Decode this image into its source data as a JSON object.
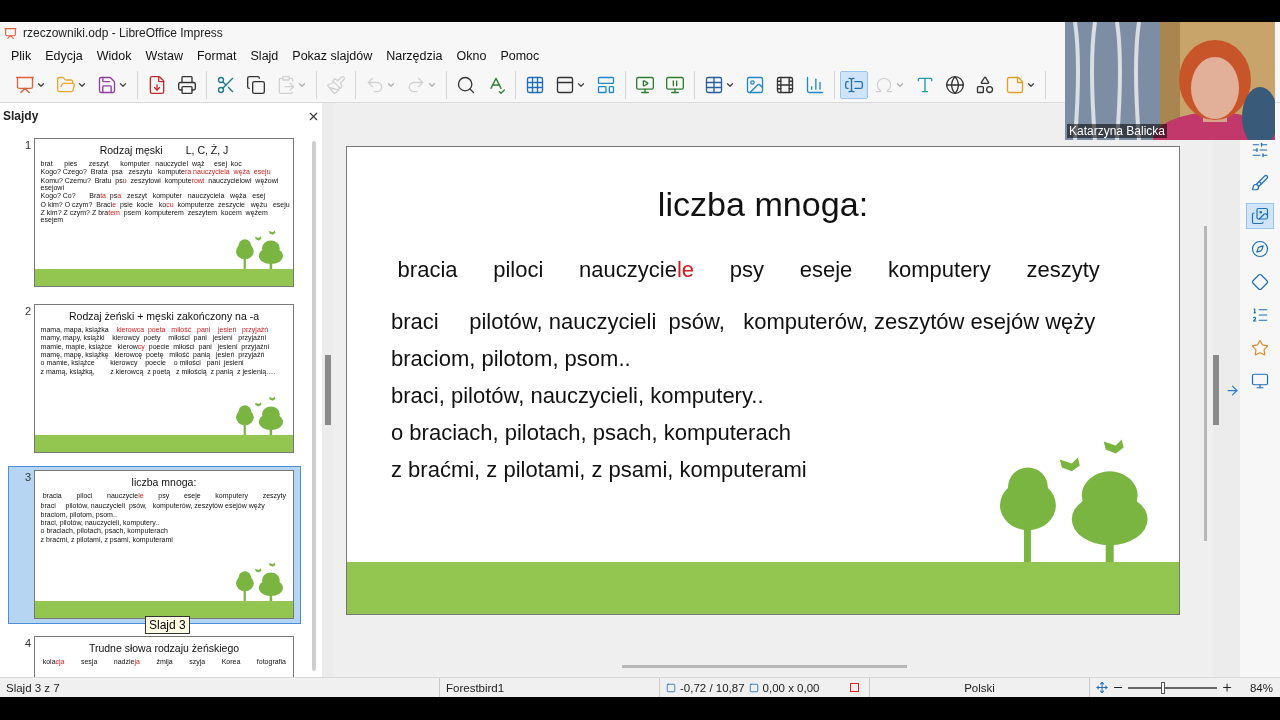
{
  "window": {
    "title": "rzeczowniki.odp - LibreOffice Impress"
  },
  "menu": [
    "Plik",
    "Edycja",
    "Widok",
    "Wstaw",
    "Format",
    "Slajd",
    "Pokaz slajdów",
    "Narzędzia",
    "Okno",
    "Pomoc"
  ],
  "toolbar": [
    [
      {
        "disabled": false,
        "selected": false,
        "dropdown": true
      },
      {
        "disabled": false,
        "selected": false,
        "dropdown": true
      },
      {
        "disabled": false,
        "selected": false,
        "dropdown": true
      }
    ],
    [
      {
        "disabled": false,
        "selected": false,
        "dropdown": false
      },
      {
        "disabled": false,
        "selected": false,
        "dropdown": false
      }
    ],
    [
      {
        "disabled": false,
        "selected": false,
        "dropdown": false
      },
      {
        "disabled": false,
        "selected": false,
        "dropdown": false
      },
      {
        "disabled": true,
        "selected": false,
        "dropdown": true
      }
    ],
    [
      {
        "disabled": true,
        "selected": false,
        "dropdown": false
      }
    ],
    [
      {
        "disabled": true,
        "selected": false,
        "dropdown": true
      },
      {
        "disabled": true,
        "selected": false,
        "dropdown": true
      }
    ],
    [
      {
        "disabled": false,
        "selected": false,
        "dropdown": false
      },
      {
        "disabled": false,
        "selected": false,
        "dropdown": false
      }
    ],
    [
      {
        "disabled": false,
        "selected": false,
        "dropdown": false
      },
      {
        "disabled": false,
        "selected": false,
        "dropdown": true
      },
      {
        "disabled": false,
        "selected": false,
        "dropdown": false
      }
    ],
    [
      {
        "disabled": false,
        "selected": false,
        "dropdown": false
      },
      {
        "disabled": false,
        "selected": false,
        "dropdown": false
      }
    ],
    [
      {
        "disabled": false,
        "selected": false,
        "dropdown": true
      },
      {
        "disabled": false,
        "selected": false,
        "dropdown": false
      },
      {
        "disabled": false,
        "selected": false,
        "dropdown": false
      },
      {
        "disabled": false,
        "selected": false,
        "dropdown": false
      }
    ],
    [
      {
        "disabled": false,
        "selected": true,
        "dropdown": false
      },
      {
        "disabled": true,
        "selected": false,
        "dropdown": true
      },
      {
        "disabled": false,
        "selected": false,
        "dropdown": false
      },
      {
        "disabled": false,
        "selected": false,
        "dropdown": false
      },
      {
        "disabled": false,
        "selected": false,
        "dropdown": false
      },
      {
        "disabled": false,
        "selected": false,
        "dropdown": true
      }
    ]
  ],
  "slides_panel": {
    "title": "Slajdy"
  },
  "slides": [
    {
      "number": "1",
      "selected": false,
      "title": [
        "Rodzaj męski",
        "L, C, Ż, J"
      ],
      "rows": [
        {
          "kind": "line",
          "parts": [
            {
              "text": "brat      pies      zeszyt      komputer   nauczyciel  wąż     esej  koc",
              "highlight": false
            }
          ]
        },
        {
          "kind": "line",
          "parts": [
            {
              "text": "Kogo? Czego?  Brata  psa   zeszytu   kompute",
              "highlight": false
            },
            {
              "text": "ra nauczyciela  węża  eseju",
              "highlight": true
            }
          ]
        },
        {
          "kind": "line",
          "parts": [
            {
              "text": "Komu? Czemu?  Bratu  ps",
              "highlight": false
            },
            {
              "text": "u",
              "highlight": true
            },
            {
              "text": "  zeszytowi  kompute",
              "highlight": false
            },
            {
              "text": "rowi",
              "highlight": true
            },
            {
              "text": "  nauczycielowi  wężowi  esejowi",
              "highlight": false
            }
          ]
        },
        {
          "kind": "line",
          "parts": [
            {
              "text": "Kogo? Co?       Bra",
              "highlight": false
            },
            {
              "text": "ta",
              "highlight": true
            },
            {
              "text": "  ps",
              "highlight": false
            },
            {
              "text": "a",
              "highlight": true
            },
            {
              "text": "   zeszyt   komputer   nauczyciela   węża   esej",
              "highlight": false
            }
          ]
        },
        {
          "kind": "line",
          "parts": [
            {
              "text": "O kim? O czym?  Braci",
              "highlight": false
            },
            {
              "text": "e",
              "highlight": true
            },
            {
              "text": "  psie  kocie   ko",
              "highlight": false
            },
            {
              "text": "cu",
              "highlight": true
            },
            {
              "text": "  komputerze  zeszycie   wężu   eseju",
              "highlight": false
            }
          ]
        },
        {
          "kind": "line",
          "parts": [
            {
              "text": "Z kim? Z czym? Z bra",
              "highlight": false
            },
            {
              "text": "tem",
              "highlight": true
            },
            {
              "text": "  psem  komputerem  zeszytem  kocem  wężem  esejem",
              "highlight": false
            }
          ]
        }
      ]
    },
    {
      "number": "2",
      "selected": false,
      "title": [
        "Rodzaj żeński + męski zakończony na -a"
      ],
      "rows": [
        {
          "kind": "line",
          "parts": [
            {
              "text": "mama, mapa, książka    ",
              "highlight": false
            },
            {
              "text": "kierowca  poeta   miłość   pani    jesień   przyjaźń",
              "highlight": true
            }
          ]
        },
        {
          "kind": "line",
          "parts": [
            {
              "text": "mamy, mapy, książki    kierowcy  poety    miłości  pani   jesieni   przyjaźni",
              "highlight": false
            }
          ]
        },
        {
          "kind": "line",
          "parts": [
            {
              "text": "mamie, mapie, książce   kierow",
              "highlight": false
            },
            {
              "text": "cy",
              "highlight": true
            },
            {
              "text": "  poecie  miłości  pani   jesieni  przyjaźni",
              "highlight": false
            }
          ]
        },
        {
          "kind": "line",
          "parts": [
            {
              "text": "mamę, mapę, książkę   kierowcę  poetę   miłość  panią   jesień  przyjaźń",
              "highlight": false
            }
          ]
        },
        {
          "kind": "line",
          "parts": [
            {
              "text": "o mamie, książce        kierowcy    poecie    o miłości   pani  jesieni",
              "highlight": false
            }
          ]
        },
        {
          "kind": "line",
          "parts": [
            {
              "text": "z mamą, książką,        z kierowcą  z poetą   z miłością  z panią  z jesienią….",
              "highlight": false
            }
          ]
        }
      ]
    },
    {
      "number": "3",
      "selected": true,
      "title": [
        "liczba mnoga:"
      ],
      "rows": [
        {
          "kind": "words",
          "words": [
            [
              {
                "text": "bracia",
                "highlight": false
              }
            ],
            [
              {
                "text": "piloci",
                "highlight": false
              }
            ],
            [
              {
                "text": "nauczycie",
                "highlight": false
              },
              {
                "text": "le",
                "highlight": true
              }
            ],
            [
              {
                "text": "psy",
                "highlight": false
              }
            ],
            [
              {
                "text": "eseje",
                "highlight": false
              }
            ],
            [
              {
                "text": "komputery",
                "highlight": false
              }
            ],
            [
              {
                "text": "zeszyty",
                "highlight": false
              }
            ]
          ]
        },
        {
          "kind": "line",
          "parts": [
            {
              "text": "braci     pilotów, nauczycieli  psów,   komputerów, zeszytów esejów węży",
              "highlight": false
            }
          ]
        },
        {
          "kind": "line",
          "parts": [
            {
              "text": "braciom, pilotom, psom..",
              "highlight": false
            }
          ]
        },
        {
          "kind": "line",
          "parts": [
            {
              "text": "braci, pilotów, nauczycieli, komputery..",
              "highlight": false
            }
          ]
        },
        {
          "kind": "line",
          "parts": [
            {
              "text": "o braciach, pilotach, psach, komputerach",
              "highlight": false
            }
          ]
        },
        {
          "kind": "line",
          "parts": [
            {
              "text": "z braćmi, z pilotami, z psami, komputerami",
              "highlight": false
            }
          ]
        }
      ]
    },
    {
      "number": "4",
      "selected": false,
      "title": [
        "Trudne słowa rodzaju żeńskiego"
      ],
      "rows": [
        {
          "kind": "words",
          "words": [
            [
              {
                "text": "kola",
                "highlight": false
              },
              {
                "text": "cja",
                "highlight": true
              }
            ],
            [
              {
                "text": "sesja",
                "highlight": false
              }
            ],
            [
              {
                "text": "nadzie",
                "highlight": false
              },
              {
                "text": "ja",
                "highlight": true
              }
            ],
            [
              {
                "text": "żmija",
                "highlight": false
              }
            ],
            [
              {
                "text": "szyja",
                "highlight": false
              }
            ],
            [
              {
                "text": "Korea",
                "highlight": false
              }
            ],
            [
              {
                "text": "fotografia",
                "highlight": false
              }
            ]
          ]
        }
      ]
    }
  ],
  "tooltip": "Slajd 3",
  "current_slide": {
    "title": [
      "liczba mnoga:"
    ],
    "rows": [
      {
        "kind": "words",
        "words": [
          [
            {
              "text": "bracia",
              "highlight": false
            }
          ],
          [
            {
              "text": "piloci",
              "highlight": false
            }
          ],
          [
            {
              "text": "nauczycie",
              "highlight": false
            },
            {
              "text": "le",
              "highlight": true
            }
          ],
          [
            {
              "text": "psy",
              "highlight": false
            }
          ],
          [
            {
              "text": "eseje",
              "highlight": false
            }
          ],
          [
            {
              "text": "komputery",
              "highlight": false
            }
          ],
          [
            {
              "text": "zeszyty",
              "highlight": false
            }
          ]
        ]
      },
      {
        "kind": "line",
        "parts": [
          {
            "text": "braci     pilotów, nauczycieli  psów,   komputerów, zeszytów esejów węży",
            "highlight": false
          }
        ]
      },
      {
        "kind": "line",
        "parts": [
          {
            "text": "braciom, pilotom, psom..",
            "highlight": false
          }
        ]
      },
      {
        "kind": "line",
        "parts": [
          {
            "text": "braci, pilotów, nauczycieli, komputery..",
            "highlight": false
          }
        ]
      },
      {
        "kind": "line",
        "parts": [
          {
            "text": "o braciach, pilotach, psach, komputerach",
            "highlight": false
          }
        ]
      },
      {
        "kind": "line",
        "parts": [
          {
            "text": "z braćmi, z pilotami, z psami, komputerami",
            "highlight": false
          }
        ]
      }
    ]
  },
  "sidebar_tabs": [
    {
      "selected": false
    },
    {
      "selected": false
    },
    {
      "selected": true
    },
    {
      "selected": false
    },
    {
      "selected": false
    },
    {
      "selected": false
    },
    {
      "selected": false
    },
    {
      "selected": false
    }
  ],
  "webcam": {
    "kind": "picture",
    "name": "Katarzyna Balicka"
  },
  "status_bar": {
    "slide": "Slajd 3 z 7",
    "master": "Forestbird1",
    "position": "-0,72 / 10,87",
    "size": "0,00 x 0,00",
    "document_modified": true,
    "language": "Polski",
    "zoom": {
      "level": 0.39,
      "reading": "84%"
    }
  }
}
